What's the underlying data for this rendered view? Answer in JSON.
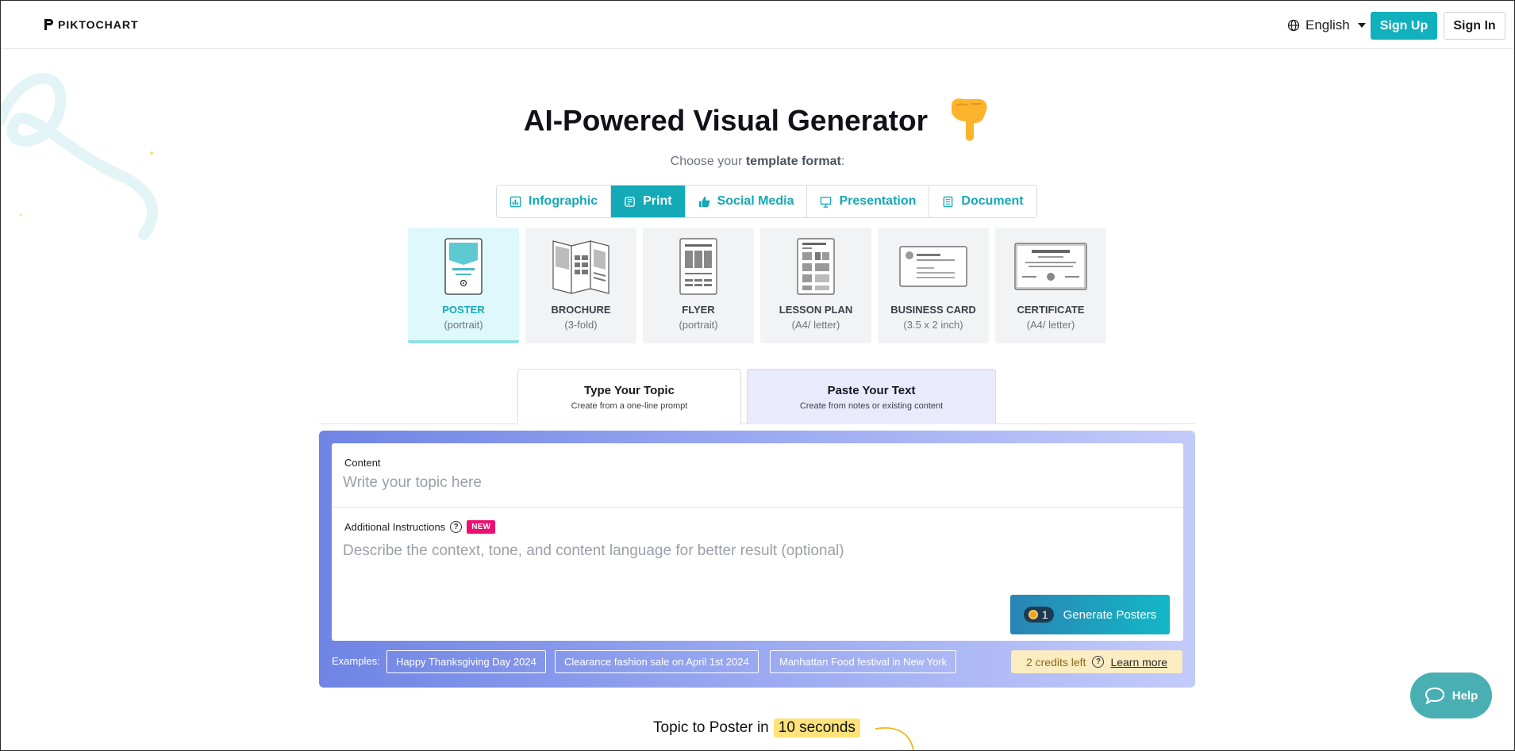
{
  "header": {
    "logo_text": "PIKTOCHART",
    "language": "English",
    "signup_label": "Sign Up",
    "signin_label": "Sign In"
  },
  "hero": {
    "title": "AI-Powered Visual Generator",
    "subtitle_prefix": "Choose your ",
    "subtitle_bold": "template format",
    "subtitle_suffix": ":"
  },
  "format_tabs": [
    {
      "label": "Infographic",
      "icon": "bar-chart-icon",
      "active": false
    },
    {
      "label": "Print",
      "icon": "print-icon",
      "active": true
    },
    {
      "label": "Social Media",
      "icon": "thumbs-up-icon",
      "active": false
    },
    {
      "label": "Presentation",
      "icon": "presentation-icon",
      "active": false
    },
    {
      "label": "Document",
      "icon": "document-icon",
      "active": false
    }
  ],
  "templates": [
    {
      "name": "POSTER",
      "sub": "(portrait)",
      "active": true
    },
    {
      "name": "BROCHURE",
      "sub": "(3-fold)",
      "active": false
    },
    {
      "name": "FLYER",
      "sub": "(portrait)",
      "active": false
    },
    {
      "name": "LESSON PLAN",
      "sub": "(A4/ letter)",
      "active": false
    },
    {
      "name": "BUSINESS CARD",
      "sub": "(3.5 x 2 inch)",
      "active": false
    },
    {
      "name": "CERTIFICATE",
      "sub": "(A4/ letter)",
      "active": false
    }
  ],
  "input_tabs": {
    "type_title": "Type Your Topic",
    "type_sub": "Create from a one-line prompt",
    "paste_title": "Paste Your Text",
    "paste_sub": "Create from notes or existing content"
  },
  "form": {
    "content_label": "Content",
    "content_placeholder": "Write your topic here",
    "additional_label": "Additional Instructions",
    "new_badge": "NEW",
    "additional_placeholder": "Describe the context, tone, and content language for better result (optional)",
    "generate_credits": "1",
    "generate_label": "Generate Posters"
  },
  "examples": {
    "label": "Examples:",
    "items": [
      "Happy Thanksgiving Day 2024",
      "Clearance fashion sale on April 1st 2024",
      "Manhattan Food festival in New York"
    ]
  },
  "credits": {
    "text": "2 credits left",
    "learn_more": "Learn more"
  },
  "teaser": {
    "prefix": "Topic to Poster in",
    "highlight": "10 seconds"
  },
  "help": {
    "label": "Help"
  },
  "colors": {
    "accent": "#14aab7",
    "new_badge": "#ef0f72",
    "credits_bg": "#fbecc2"
  }
}
